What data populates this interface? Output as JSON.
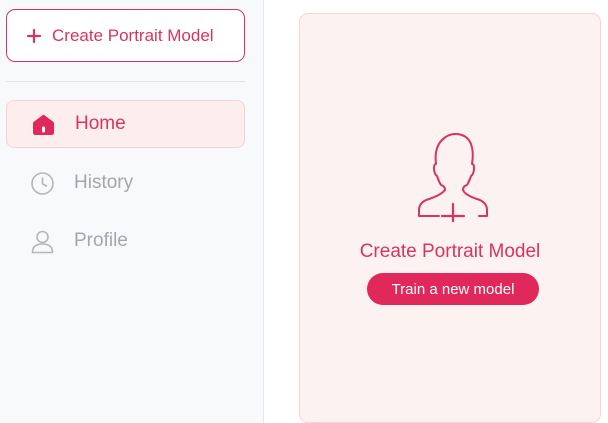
{
  "sidebar": {
    "create_button_label": "Create Portrait Model",
    "nav": [
      {
        "label": "Home",
        "icon": "home-icon",
        "active": true
      },
      {
        "label": "History",
        "icon": "clock-icon",
        "active": false
      },
      {
        "label": "Profile",
        "icon": "user-icon",
        "active": false
      }
    ]
  },
  "main": {
    "card": {
      "icon": "user-add-icon",
      "title": "Create Portrait Model",
      "button_label": "Train a new model"
    }
  },
  "colors": {
    "accent": "#d6355d",
    "accent_button": "#e0285a",
    "active_bg": "#fdeeee",
    "card_bg": "#fdf2f2",
    "muted_text": "#a3a6ad",
    "sidebar_bg": "#f8f9fb"
  }
}
